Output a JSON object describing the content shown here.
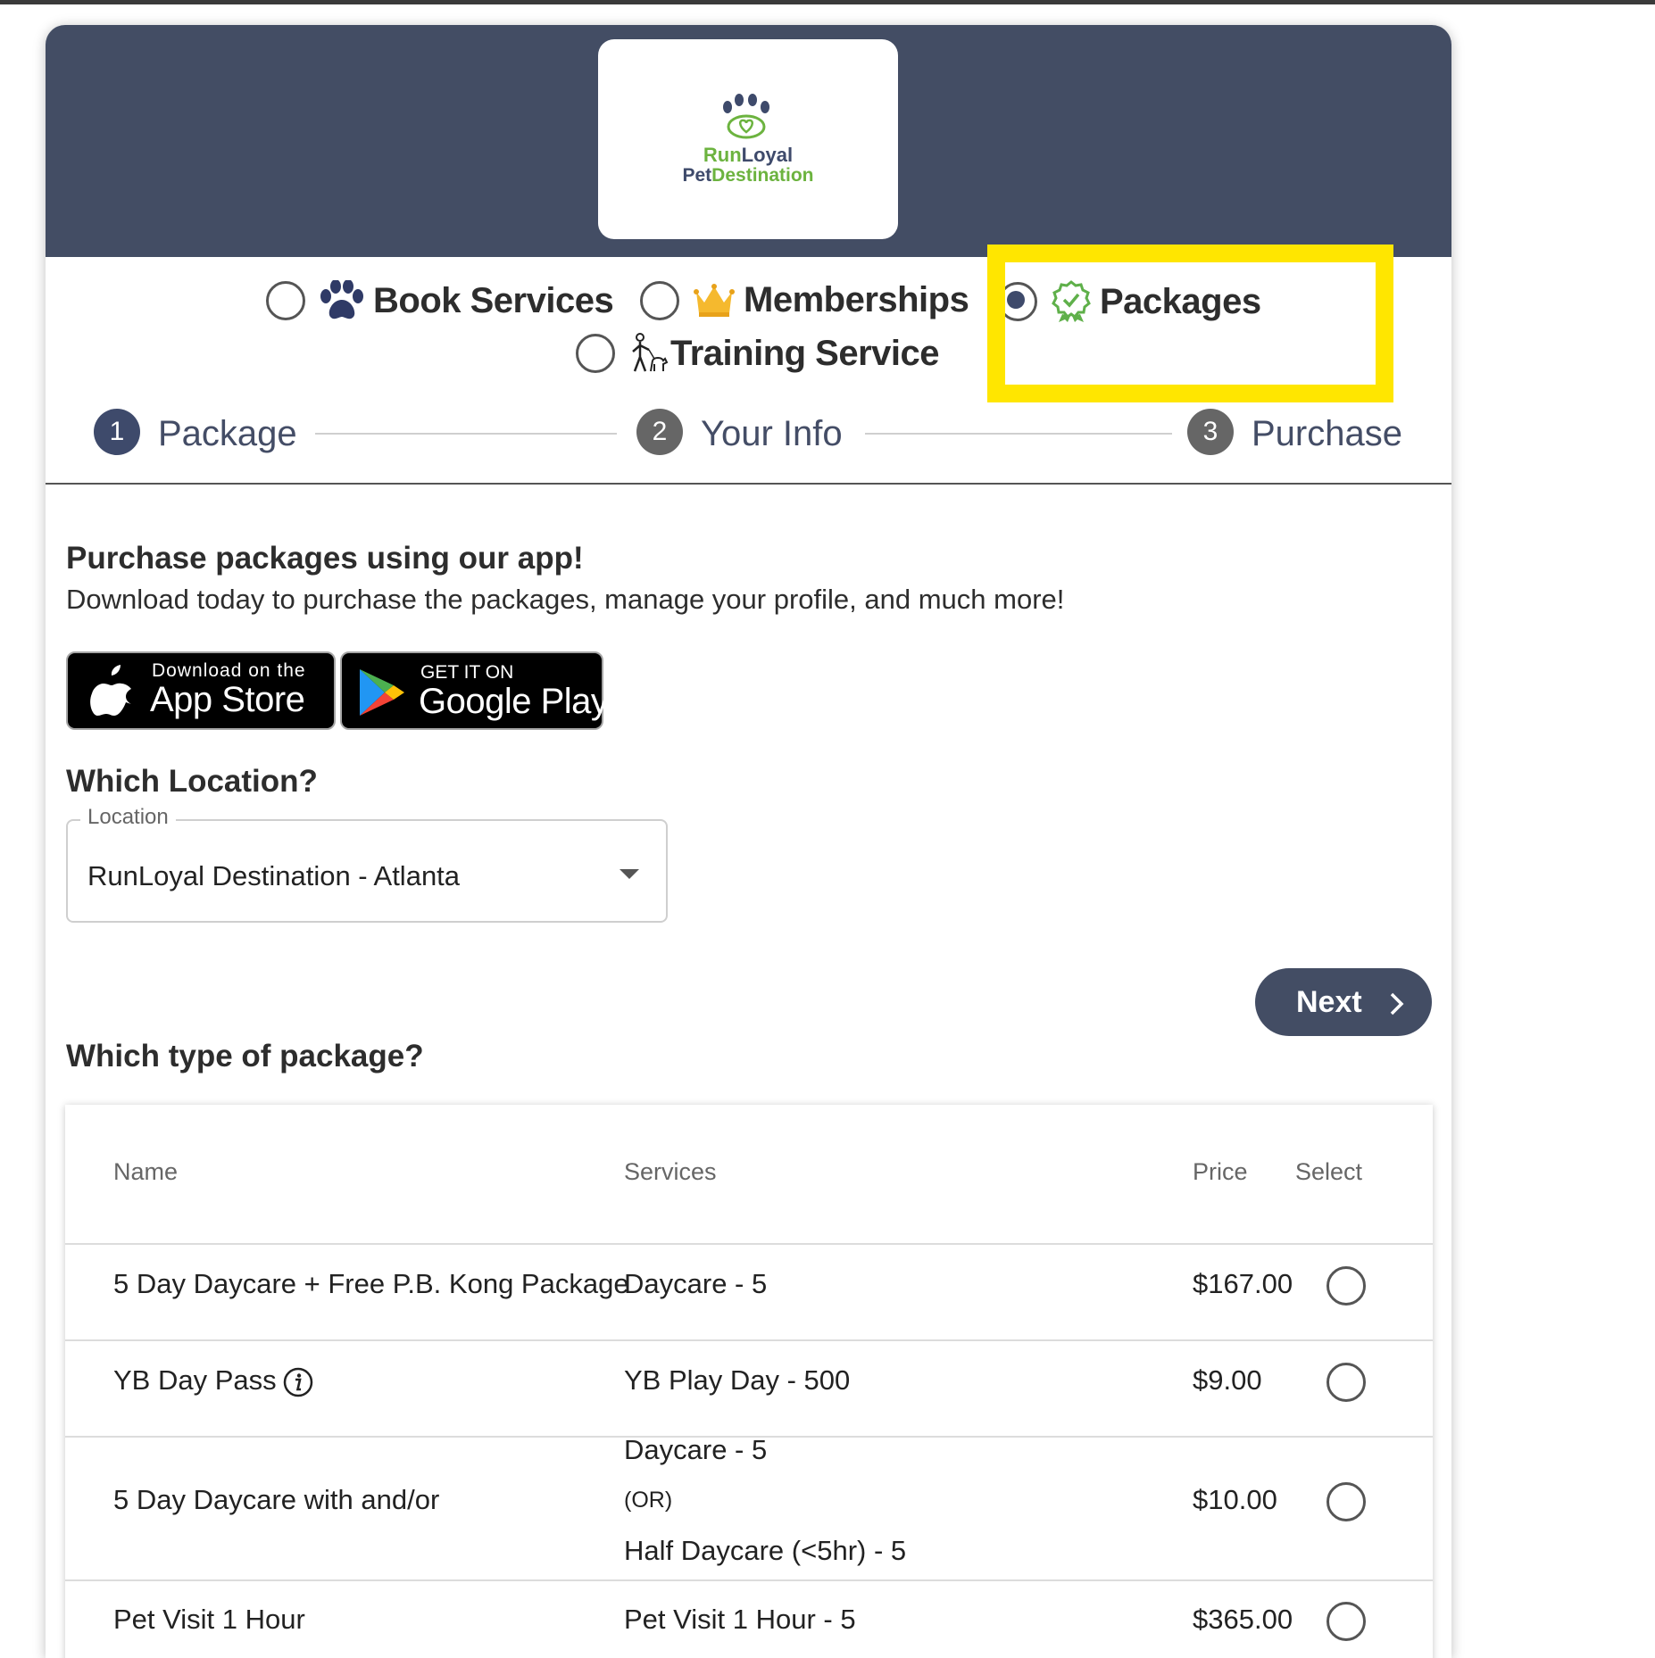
{
  "brand": {
    "line1_a": "Run",
    "line1_b": "Loyal",
    "line2_a": "Pet",
    "line2_b": "Destination"
  },
  "modes": [
    {
      "label": "Book Services",
      "icon": "paw-icon",
      "selected": false
    },
    {
      "label": "Memberships",
      "icon": "crown-icon",
      "selected": false
    },
    {
      "label": "Packages",
      "icon": "badge-check-icon",
      "selected": true
    },
    {
      "label": "Training Service",
      "icon": "dog-trainer-icon",
      "selected": false
    }
  ],
  "steps": [
    {
      "number": "1",
      "label": "Package",
      "active": true
    },
    {
      "number": "2",
      "label": "Your Info",
      "active": false
    },
    {
      "number": "3",
      "label": "Purchase",
      "active": false
    }
  ],
  "promo": {
    "title": "Purchase packages using our app!",
    "subtitle": "Download today to purchase the packages, manage your profile, and much more!"
  },
  "app_store": {
    "small": "Download on the",
    "big": "App Store"
  },
  "google_play": {
    "small": "GET IT ON",
    "big": "Google Play"
  },
  "location": {
    "heading": "Which Location?",
    "label": "Location",
    "value": "RunLoyal Destination - Atlanta"
  },
  "next_label": "Next",
  "packages": {
    "heading": "Which type of package?",
    "columns": {
      "name": "Name",
      "services": "Services",
      "price": "Price",
      "select": "Select"
    },
    "rows": [
      {
        "name": "5 Day Daycare + Free P.B. Kong Package",
        "services": [
          "Daycare - 5"
        ],
        "price": "$167.00"
      },
      {
        "name": "YB Day Pass",
        "services": [
          "YB Play Day - 500"
        ],
        "price": "$9.00"
      },
      {
        "name": "5 Day Daycare with and/or",
        "services": [
          "Daycare - 5",
          "(OR)",
          "Half Daycare (<5hr) - 5"
        ],
        "price": "$10.00"
      },
      {
        "name": "Pet Visit 1 Hour",
        "services": [
          "Pet Visit 1 Hour - 5"
        ],
        "price": "$365.00"
      }
    ]
  },
  "colors": {
    "header_bg": "#434d64",
    "highlight": "#ffe600",
    "brand_green": "#6cb33f",
    "step_active": "#3e4a6b",
    "step_inactive": "#666666"
  }
}
